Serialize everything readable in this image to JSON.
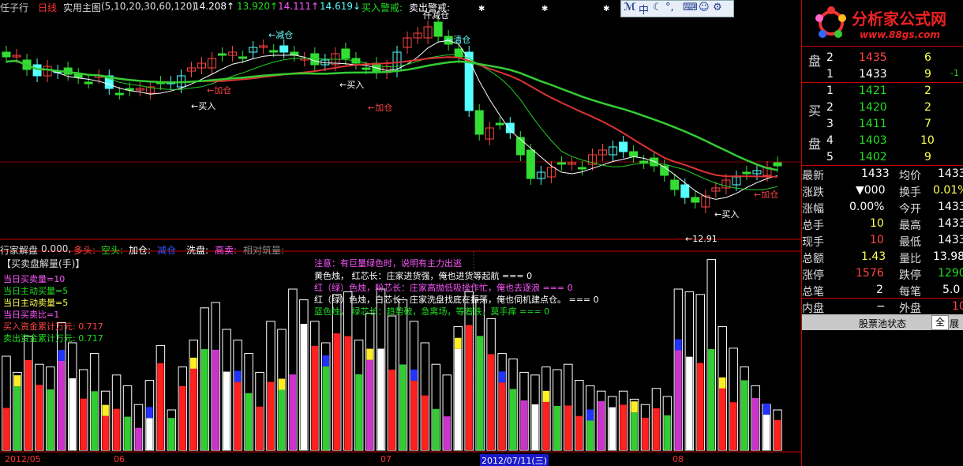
{
  "header": {
    "stock_name": "任子行",
    "period": "日线",
    "indicator_name": "实用主图",
    "params": "(5,10,20,30,60,120)",
    "ma_values": [
      {
        "text": "14.208↑",
        "color": "#ffffff"
      },
      {
        "text": "13.920↑",
        "color": "#22dd22"
      },
      {
        "text": "14.111↑",
        "color": "#ff55ff"
      },
      {
        "text": "14.619↓",
        "color": "#55ffff"
      }
    ],
    "buy_alert": "买入警戒:",
    "sell_alert": "卖出警戒:",
    "top_annotation": "仟减仓"
  },
  "annotations": [
    {
      "text": "←减仓",
      "color": "#66ffff"
    },
    {
      "text": "←清仓",
      "color": "#66ffff"
    },
    {
      "text": "←买入",
      "color": "#ffffff"
    },
    {
      "text": "←加仓",
      "color": "#ff4444"
    },
    {
      "text": "←买入",
      "color": "#ffffff"
    },
    {
      "text": "←加仓",
      "color": "#ff4444"
    },
    {
      "text": "←买入",
      "color": "#ffffff"
    },
    {
      "text": "←加仓",
      "color": "#ff4444"
    },
    {
      "text": "←12.91",
      "color": "#ffffff"
    }
  ],
  "sub_indicator": {
    "name": "行家解盘",
    "value": "0.000,",
    "items": [
      {
        "text": "多头:",
        "color": "#ff4444"
      },
      {
        "text": "空头:",
        "color": "#22dd22"
      },
      {
        "text": "加仓:",
        "color": "#ffffff"
      },
      {
        "text": "减仓",
        "color": "#3355ff"
      },
      {
        "text": "洗盘:",
        "color": "#ffffff"
      },
      {
        "text": "高卖:",
        "color": "#ff55ff"
      },
      {
        "text": "相对筑量:",
        "color": "#888888"
      }
    ]
  },
  "stats": {
    "title": "【买卖盘解量(手)】",
    "lines": [
      {
        "text": "当日买卖量=10",
        "color": "#ff55ff"
      },
      {
        "text": "当日主动买量=5",
        "color": "#22dd22"
      },
      {
        "text": "当日主动卖量=5",
        "color": "#ffff55"
      },
      {
        "text": "当日买卖比=1",
        "color": "#ff55ff"
      },
      {
        "text": "买入资金累计万元: 0.717",
        "color": "#ff4444"
      },
      {
        "text": "卖出资金累计万元: 0.717",
        "color": "#22dd22"
      }
    ]
  },
  "notes": [
    {
      "text": "注意：有巨量绿色时，说明有主力出逃",
      "color": "#ff55ff"
    },
    {
      "text": "黄色烛，      红芯长：庄家进货强，俺也进货等起航 === 0",
      "color": "#ffffff"
    },
    {
      "text": "红（绿）色烛，粉芯长：庄家高抛低吸操作忙，俺也去逐浪 === 0",
      "color": "#ff55ff"
    },
    {
      "text": "红（绿）色烛，白芯长：庄家洗盘找底在振荡，俺也伺机建点仓。 === 0",
      "color": "#ffffff"
    },
    {
      "text": "蓝色烛，      绿芯长：趋势破，急离场，等着跌，莫手痒 === 0",
      "color": "#22dd22"
    }
  ],
  "axis_ticks": [
    "2012/05",
    "06",
    "07",
    "2012/07/11(三)",
    "08"
  ],
  "brand": {
    "name": "分析家公式网",
    "url": "www.88gs.com"
  },
  "ime": {
    "label": "中",
    "extra": "°,"
  },
  "order_book": {
    "sell_label": [
      "盘"
    ],
    "sell": [
      {
        "level": "2",
        "price": "1435",
        "vol": "6",
        "chg": ""
      },
      {
        "level": "1",
        "price": "1433",
        "vol": "9",
        "chg": "-1"
      }
    ],
    "buy_label": [
      "买",
      "盘"
    ],
    "buy": [
      {
        "level": "1",
        "price": "1421",
        "vol": "2",
        "chg": ""
      },
      {
        "level": "2",
        "price": "1420",
        "vol": "2",
        "chg": ""
      },
      {
        "level": "3",
        "price": "1411",
        "vol": "7",
        "chg": ""
      },
      {
        "level": "4",
        "price": "1403",
        "vol": "10",
        "chg": ""
      },
      {
        "level": "5",
        "price": "1402",
        "vol": "9",
        "chg": ""
      }
    ]
  },
  "quote": [
    {
      "l1": "最新",
      "v1": "1433",
      "c1": "#ffffff",
      "l2": "均价",
      "v2": "1433",
      "c2": "#ffffff"
    },
    {
      "l1": "涨跌",
      "v1": "▼000",
      "c1": "#ffffff",
      "l2": "换手",
      "v2": "0.01%",
      "c2": "#ffff55"
    },
    {
      "l1": "涨幅",
      "v1": "0.00%",
      "c1": "#ffffff",
      "l2": "今开",
      "v2": "1433",
      "c2": "#ffffff"
    },
    {
      "l1": "总手",
      "v1": "10",
      "c1": "#ffff55",
      "l2": "最高",
      "v2": "1433",
      "c2": "#ffffff"
    },
    {
      "l1": "现手",
      "v1": "10",
      "c1": "#ff4444",
      "l2": "最低",
      "v2": "1433",
      "c2": "#ffffff"
    },
    {
      "l1": "总额",
      "v1": "1.43",
      "c1": "#ffff55",
      "l2": "量比",
      "v2": "13.98",
      "c2": "#ffffff"
    },
    {
      "l1": "涨停",
      "v1": "1576",
      "c1": "#ff4444",
      "l2": "跌停",
      "v2": "1290",
      "c2": "#22dd22"
    },
    {
      "l1": "总笔",
      "v1": "2",
      "c1": "#ffffff",
      "l2": "每笔",
      "v2": "5.0",
      "c2": "#ffffff"
    },
    {
      "l1": "内盘",
      "v1": "−",
      "c1": "#ffffff",
      "l2": "外盘",
      "v2": "10",
      "c2": "#ff4444"
    }
  ],
  "footer": {
    "pool": "股票池状态",
    "all": "全",
    "expand": "展"
  }
}
